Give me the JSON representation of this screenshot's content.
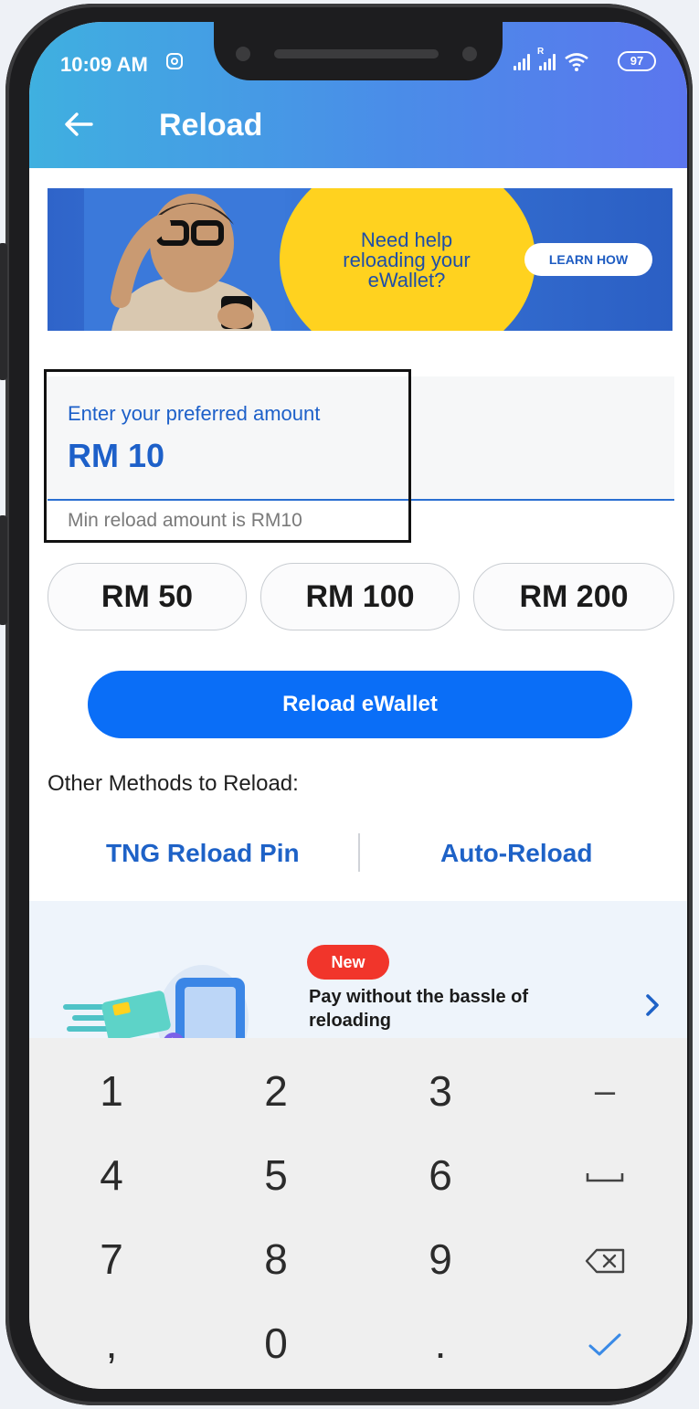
{
  "status_bar": {
    "time": "10:09 AM",
    "battery": "97",
    "sim2_label": "R"
  },
  "header": {
    "title": "Reload"
  },
  "banner": {
    "text_line1": "Need help",
    "text_line2": "reloading your",
    "text_line3": "eWallet?",
    "cta": "LEARN HOW"
  },
  "amount": {
    "label": "Enter your preferred amount",
    "value": "RM 10",
    "hint": "Min reload amount is RM10"
  },
  "quick_amounts": [
    {
      "label": "RM 50"
    },
    {
      "label": "RM 100"
    },
    {
      "label": "RM 200"
    }
  ],
  "reload_button": {
    "label": "Reload eWallet"
  },
  "other_methods": {
    "label": "Other Methods to Reload:",
    "pin": "TNG Reload Pin",
    "auto": "Auto-Reload"
  },
  "promo": {
    "badge": "New",
    "title": "Pay without the bassle of reloading"
  },
  "keyboard": {
    "rows": [
      [
        "1",
        "2",
        "3",
        "–"
      ],
      [
        "4",
        "5",
        "6",
        "space"
      ],
      [
        "7",
        "8",
        "9",
        "backspace"
      ],
      [
        ",",
        "0",
        ".",
        "done"
      ]
    ]
  },
  "colors": {
    "accent": "#0a6ef7",
    "link": "#1e62c7",
    "header_start": "#3fb0e0",
    "header_end": "#5b76ee",
    "badge": "#f1352b",
    "banner_yellow": "#ffd21f"
  }
}
